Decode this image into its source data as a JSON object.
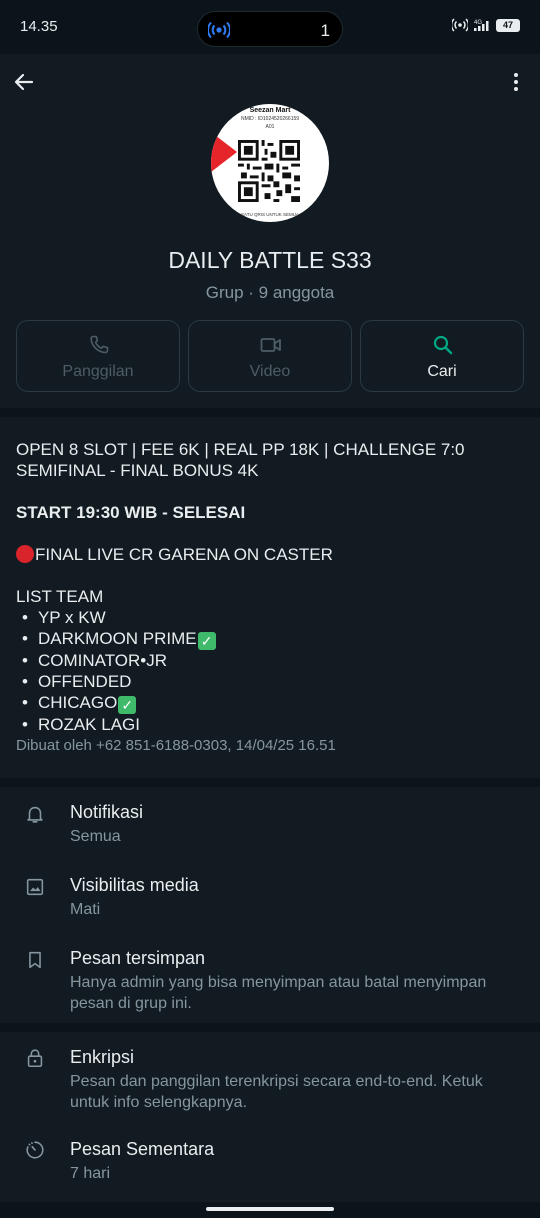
{
  "status": {
    "time": "14.35",
    "notification_count": "1",
    "battery": "47"
  },
  "header": {
    "avatar": {
      "store_name": "Seezan Mart",
      "nmid": "NMID : ID1024520266159",
      "code": "A01",
      "footer": "SATU QRIS UNTUK SEMUA"
    },
    "title": "DAILY BATTLE S33",
    "subtitle": "Grup · 9 anggota"
  },
  "actions": {
    "call": {
      "label": "Panggilan",
      "icon": "phone-icon"
    },
    "video": {
      "label": "Video",
      "icon": "video-icon"
    },
    "search": {
      "label": "Cari",
      "icon": "search-icon"
    }
  },
  "description": {
    "line1": "OPEN 8 SLOT | FEE 6K | REAL PP 18K | CHALLENGE 7:0",
    "line2": "SEMIFINAL - FINAL BONUS 4K",
    "start": "START 19:30 WIB - SELESAI",
    "final_live": "FINAL LIVE CR GARENA ON CASTER",
    "list_title": "LIST TEAM",
    "teams": [
      "YP x KW",
      "DARKMOON PRIME",
      "COMINATOR•JR",
      "OFFENDED",
      "CHICAGO",
      "ROZAK LAGI"
    ],
    "created_by": "Dibuat oleh +62 851-6188-0303, 14/04/25 16.51"
  },
  "settings": {
    "notifications": {
      "title": "Notifikasi",
      "value": "Semua"
    },
    "media_visibility": {
      "title": "Visibilitas media",
      "value": "Mati"
    },
    "saved_messages": {
      "title": "Pesan tersimpan",
      "value": "Hanya admin yang bisa menyimpan atau batal menyimpan pesan di grup ini."
    },
    "encryption": {
      "title": "Enkripsi",
      "value": "Pesan dan panggilan terenkripsi secara end-to-end. Ketuk untuk info selengkapnya."
    },
    "disappearing": {
      "title": "Pesan Sementara",
      "value": "7 hari"
    }
  },
  "colors": {
    "background": "#0b141a",
    "panel": "#111b21",
    "accent": "#00a884",
    "muted": "#8696a0",
    "check": "#3fba6b",
    "red": "#d9242b"
  }
}
